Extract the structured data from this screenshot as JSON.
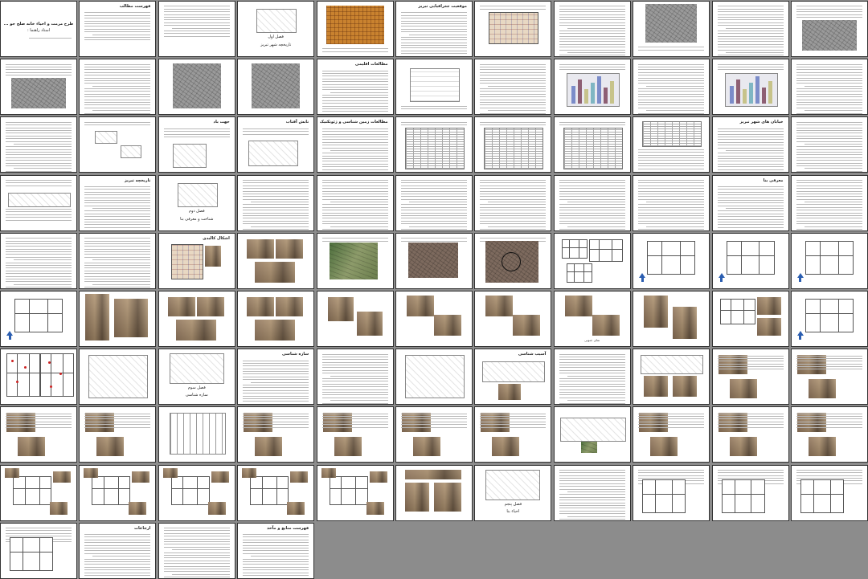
{
  "viewer": {
    "layout": "thumbnail-grid",
    "columns": 11,
    "page_count": 92
  },
  "pages": [
    {
      "k": "cover",
      "title": "طرح مرمت و احیاء خانه صلح جو ...",
      "sub": "استاد راهنما :"
    },
    {
      "k": "toc",
      "title": "فهرست مطالب"
    },
    {
      "k": "toc2"
    },
    {
      "k": "chapter",
      "title": "فصل اول",
      "sub": "تاریخچه شهر تبریز"
    },
    {
      "k": "oldmap"
    },
    {
      "k": "text",
      "title": "موقعیت جغرافیایی تبریز"
    },
    {
      "k": "colormap"
    },
    {
      "k": "text"
    },
    {
      "k": "sketchmap"
    },
    {
      "k": "text"
    },
    {
      "k": "aerial-half"
    },
    {
      "k": "aerial-half"
    },
    {
      "k": "text"
    },
    {
      "k": "aerial-full"
    },
    {
      "k": "aerial-full"
    },
    {
      "k": "text",
      "title": "مطالعات اقلیمی"
    },
    {
      "k": "graph"
    },
    {
      "k": "text"
    },
    {
      "k": "chart"
    },
    {
      "k": "text"
    },
    {
      "k": "chart"
    },
    {
      "k": "text"
    },
    {
      "k": "text"
    },
    {
      "k": "sketch"
    },
    {
      "k": "text-sketch",
      "title": "جهت باد"
    },
    {
      "k": "sketch2",
      "title": "تابش آفتاب"
    },
    {
      "k": "text",
      "title": "مطالعات زمین شناسی و ژئوتکنیک"
    },
    {
      "k": "tablepage"
    },
    {
      "k": "tablepage"
    },
    {
      "k": "tablepage"
    },
    {
      "k": "table-text"
    },
    {
      "k": "text",
      "title": "خیابان های شهر تبریز"
    },
    {
      "k": "text"
    },
    {
      "k": "sketch-row"
    },
    {
      "k": "text",
      "title": "تاریخچه تبریز"
    },
    {
      "k": "chapter",
      "title": "فصل دوم",
      "sub": "شناخت و معرفی بنا"
    },
    {
      "k": "text"
    },
    {
      "k": "text"
    },
    {
      "k": "text"
    },
    {
      "k": "text"
    },
    {
      "k": "text"
    },
    {
      "k": "text"
    },
    {
      "k": "text",
      "title": "معرفی بنا"
    },
    {
      "k": "text"
    },
    {
      "k": "text"
    },
    {
      "k": "text"
    },
    {
      "k": "plans",
      "title": "اشکال کالبدی"
    },
    {
      "k": "photos"
    },
    {
      "k": "aerial-green"
    },
    {
      "k": "aerial-color"
    },
    {
      "k": "aerial-color-c"
    },
    {
      "k": "plans-b"
    },
    {
      "k": "plan-single"
    },
    {
      "k": "plan-single"
    },
    {
      "k": "plan-single"
    },
    {
      "k": "plan-single"
    },
    {
      "k": "photo-tall"
    },
    {
      "k": "photos"
    },
    {
      "k": "photos"
    },
    {
      "k": "photos-b"
    },
    {
      "k": "photos-c"
    },
    {
      "k": "photos-c"
    },
    {
      "k": "photos-c",
      "cap": "نمای جنوبی"
    },
    {
      "k": "photos-d"
    },
    {
      "k": "plan-photo"
    },
    {
      "k": "plan-single"
    },
    {
      "k": "plan-red"
    },
    {
      "k": "iso"
    },
    {
      "k": "iso-chapter",
      "title": "فصل سوم",
      "sub": "سازه شناسی"
    },
    {
      "k": "text",
      "title": "سازه شناسی"
    },
    {
      "k": "text"
    },
    {
      "k": "iso"
    },
    {
      "k": "elev",
      "title": "آسیب شناسی"
    },
    {
      "k": "text"
    },
    {
      "k": "elev2"
    },
    {
      "k": "photo-text"
    },
    {
      "k": "photo-text"
    },
    {
      "k": "photo-text"
    },
    {
      "k": "photo-text"
    },
    {
      "k": "elevation"
    },
    {
      "k": "photo-text"
    },
    {
      "k": "photo-text"
    },
    {
      "k": "photo-text"
    },
    {
      "k": "photo-text"
    },
    {
      "k": "tree-elev"
    },
    {
      "k": "photo-text"
    },
    {
      "k": "photo-text"
    },
    {
      "k": "photo-text"
    },
    {
      "k": "plan-photos"
    },
    {
      "k": "plan-photos"
    },
    {
      "k": "plan-photos"
    },
    {
      "k": "plan-photos"
    },
    {
      "k": "plan-photos"
    },
    {
      "k": "photo-strip"
    },
    {
      "k": "iso-chapter",
      "title": "فصل پنجم",
      "sub": "احیاء بنا"
    },
    {
      "k": "text"
    },
    {
      "k": "plan-list"
    },
    {
      "k": "plan-list"
    },
    {
      "k": "plan-list"
    },
    {
      "k": "plan-list"
    },
    {
      "k": "text",
      "title": "ارجاعات"
    },
    {
      "k": "text"
    },
    {
      "k": "text",
      "title": "فهرست منابع و مآخذ"
    }
  ]
}
